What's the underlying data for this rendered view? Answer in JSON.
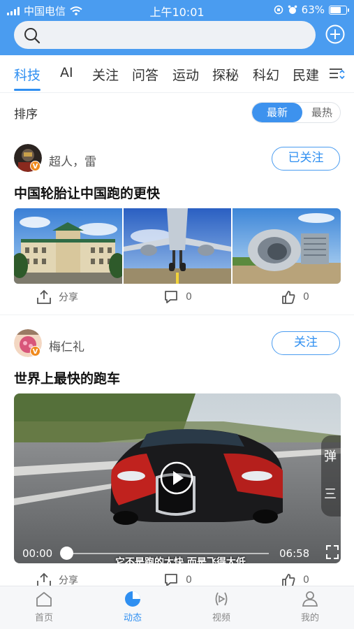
{
  "status": {
    "carrier": "中国电信",
    "time": "上午10:01",
    "battery": "63%"
  },
  "search": {
    "placeholder": ""
  },
  "tabs": [
    "科技",
    "AI",
    "关注",
    "问答",
    "运动",
    "探秘",
    "科幻",
    "民建"
  ],
  "sort": {
    "label": "排序",
    "options": [
      "最新",
      "最热"
    ],
    "selected": "最新"
  },
  "posts": [
    {
      "author": "超人，雷",
      "follow_label": "已关注",
      "title": "中国轮胎让中国跑的更快",
      "share_label": "分享",
      "comments": "0",
      "likes": "0"
    },
    {
      "author": "梅仁礼",
      "follow_label": "关注",
      "title": "世界上最快的跑车",
      "video": {
        "current": "00:00",
        "duration": "06:58",
        "progress": 0,
        "subtitle": "它不是跑的太快 而是飞得太低",
        "side_text_1": "弹",
        "side_text_2": "三"
      },
      "share_label": "分享",
      "comments": "0",
      "likes": "0"
    }
  ],
  "badge_letter": "V",
  "bottom_nav": [
    "首页",
    "动态",
    "视频",
    "我的"
  ],
  "bottom_nav_active": "动态",
  "colors": {
    "brand": "#4a9cf0",
    "accent": "#2f8ff1",
    "badge": "#f08a1e"
  }
}
